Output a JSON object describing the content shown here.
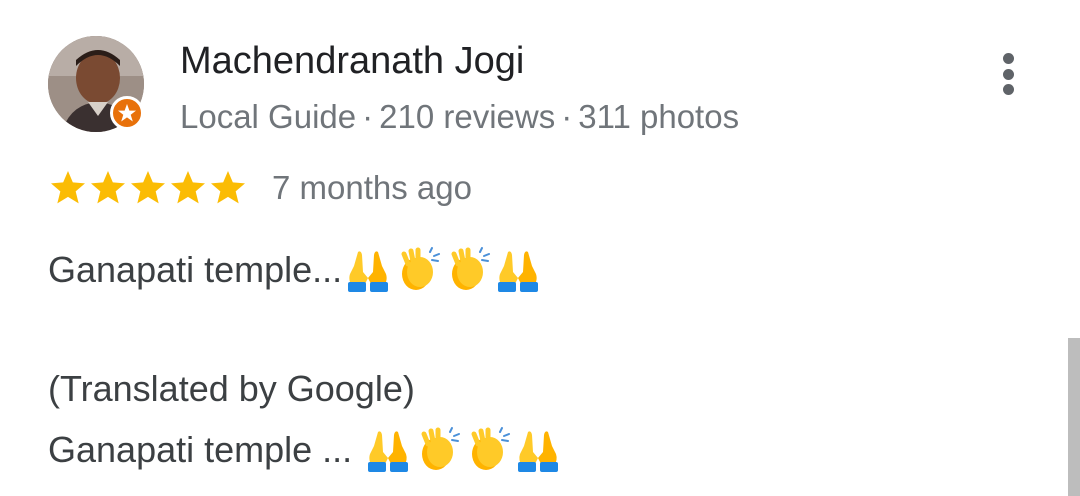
{
  "review": {
    "author": {
      "name": "Machendranath Jogi",
      "role": "Local Guide",
      "reviews": "210 reviews",
      "photos": "311 photos",
      "separator": "·"
    },
    "rating": {
      "stars": 5,
      "max": 5,
      "star_color": "#fbbc04"
    },
    "date": "7 months ago",
    "text_original": "Ganapati temple...",
    "original_emoji": [
      "folded-hands-icon",
      "clapping-hands-icon",
      "clapping-hands-icon",
      "folded-hands-icon"
    ],
    "translation_label": "(Translated by Google)",
    "text_translated": "Ganapati temple ...",
    "translated_emoji": [
      "folded-hands-icon",
      "clapping-hands-icon",
      "clapping-hands-icon",
      "folded-hands-icon"
    ]
  },
  "colors": {
    "local_guide_badge": "#e8710a",
    "name": "#202124",
    "meta": "#70757a",
    "body": "#3c4043"
  }
}
